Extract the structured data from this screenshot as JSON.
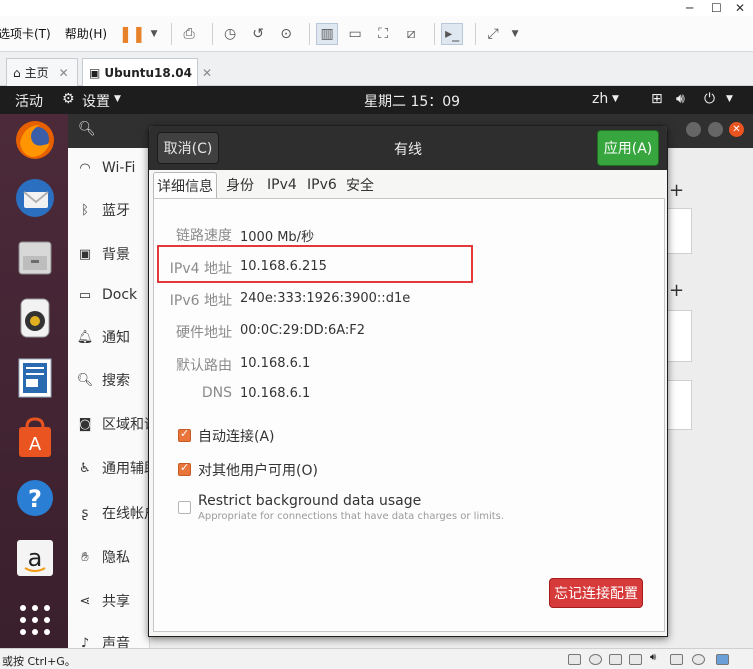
{
  "host": {
    "menu": [
      "选项卡(T)",
      "帮助(H)"
    ],
    "tabs": [
      {
        "label": "主页",
        "icon": "home-icon"
      },
      {
        "label": "Ubuntu18.04",
        "icon": "vm-icon"
      }
    ],
    "status_hint": "或按 Ctrl+G。"
  },
  "guest": {
    "topbar": {
      "activities": "活动",
      "app_menu": "设置",
      "clock": "星期二 15：09",
      "input_method": "zh"
    },
    "settings_sidebar": [
      "Wi-Fi",
      "蓝牙",
      "背景",
      "Dock",
      "通知",
      "搜索",
      "区域和语言",
      "通用辅助功能",
      "在线帐户",
      "隐私",
      "共享",
      "声音"
    ],
    "dialog": {
      "title": "有线",
      "cancel_label": "取消(C)",
      "apply_label": "应用(A)",
      "tabs": [
        "详细信息",
        "身份",
        "IPv4",
        "IPv6",
        "安全"
      ],
      "details": [
        {
          "label": "链路速度",
          "value": "1000 Mb/秒"
        },
        {
          "label": "IPv4 地址",
          "value": "10.168.6.215"
        },
        {
          "label": "IPv6 地址",
          "value": "240e:333:1926:3900::d1e"
        },
        {
          "label": "硬件地址",
          "value": "00:0C:29:DD:6A:F2"
        },
        {
          "label": "默认路由",
          "value": "10.168.6.1"
        },
        {
          "label": "DNS",
          "value": "10.168.6.1"
        }
      ],
      "options": [
        {
          "label": "自动连接(A)",
          "checked": true
        },
        {
          "label": "对其他用户可用(O)",
          "checked": true
        },
        {
          "label": "Restrict background data usage",
          "sublabel": "Appropriate for connections that have data charges or limits.",
          "checked": false
        }
      ],
      "forget_label": "忘记连接配置"
    }
  },
  "colors": {
    "apply": "#38a63f",
    "forget": "#d63a3a",
    "checkbox": "#e9753a",
    "highlight": "#e23a3a"
  }
}
